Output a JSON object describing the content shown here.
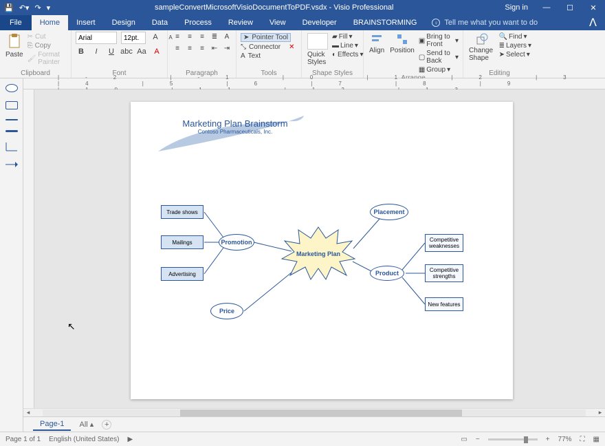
{
  "titlebar": {
    "filename": "sampleConvertMicrosoftVisioDocumentToPDF.vsdx - Visio Professional",
    "signin": "Sign in"
  },
  "tabs": {
    "file": "File",
    "home": "Home",
    "insert": "Insert",
    "design": "Design",
    "data": "Data",
    "process": "Process",
    "review": "Review",
    "view": "View",
    "developer": "Developer",
    "brainstorming": "BRAINSTORMING",
    "tellme": "Tell me what you want to do"
  },
  "ribbon": {
    "clipboard": {
      "label": "Clipboard",
      "paste": "Paste",
      "cut": "Cut",
      "copy": "Copy",
      "fmt": "Format Painter"
    },
    "font": {
      "label": "Font",
      "name": "Arial",
      "size": "12pt."
    },
    "paragraph": {
      "label": "Paragraph"
    },
    "tools": {
      "label": "Tools",
      "pointer": "Pointer Tool",
      "connector": "Connector",
      "text": "Text"
    },
    "shapeStyles": {
      "label": "Shape Styles",
      "quick": "Quick Styles",
      "fill": "Fill",
      "line": "Line",
      "effects": "Effects"
    },
    "arrange": {
      "label": "Arrange",
      "align": "Align",
      "position": "Position",
      "bringFront": "Bring to Front",
      "sendBack": "Send to Back",
      "group": "Group"
    },
    "editing": {
      "label": "Editing",
      "change": "Change Shape",
      "find": "Find",
      "layers": "Layers",
      "select": "Select"
    }
  },
  "diagram": {
    "title": "Marketing Plan Brainstorm",
    "subtitle": "Contoso Pharmaceuticals, Inc.",
    "central": "Marketing Plan",
    "promotion": "Promotion",
    "price": "Price",
    "placement": "Placement",
    "product": "Product",
    "tradeShows": "Trade shows",
    "mailings": "Mailings",
    "advertising": "Advertising",
    "compWeak": "Competitive weaknesses",
    "compStr": "Competitive strengths",
    "newFeat": "New features"
  },
  "ruler": {
    "ticks": "0123456789"
  },
  "pageTabs": {
    "page1": "Page-1",
    "all": "All ▴"
  },
  "status": {
    "page": "Page 1 of 1",
    "lang": "English (United States)",
    "zoom": "77%"
  }
}
